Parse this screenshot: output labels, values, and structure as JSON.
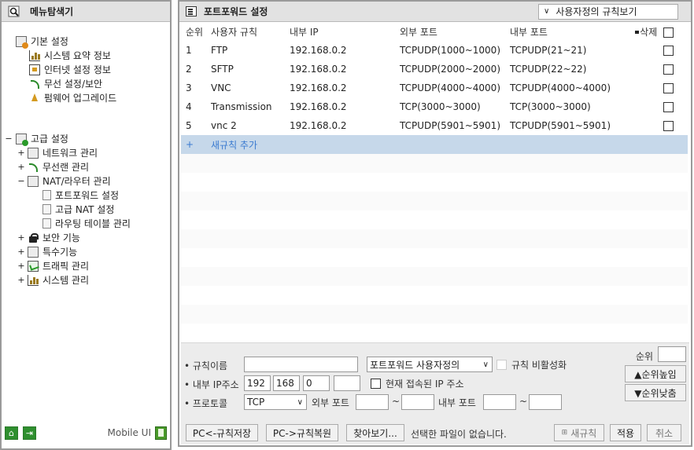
{
  "sidebar": {
    "title": "메뉴탐색기",
    "basic": {
      "label": "기본 설정",
      "items": [
        "시스템 요약 정보",
        "인터넷 설정 정보",
        "무선 설정/보안",
        "펌웨어 업그레이드"
      ]
    },
    "advanced": {
      "label": "고급 설정",
      "items": [
        {
          "toggle": "+",
          "label": "네트워크 관리"
        },
        {
          "toggle": "+",
          "label": "무선랜 관리"
        },
        {
          "toggle": "−",
          "label": "NAT/라우터 관리"
        },
        {
          "toggle": "+",
          "label": "보안 기능"
        },
        {
          "toggle": "+",
          "label": "특수기능"
        },
        {
          "toggle": "+",
          "label": "트래픽 관리"
        },
        {
          "toggle": "+",
          "label": "시스템 관리"
        }
      ],
      "nat_children": [
        "포트포워드 설정",
        "고급 NAT 설정",
        "라우팅 테이블 관리"
      ]
    },
    "advanced_toggle": "−",
    "footer": {
      "mobile_label": "Mobile UI"
    }
  },
  "main": {
    "title": "포트포워드 설정",
    "view_select": "사용자정의 규칙보기",
    "table": {
      "headers": [
        "순위",
        "사용자 규칙",
        "내부 IP",
        "외부 포트",
        "내부 포트",
        "삭제"
      ],
      "rows": [
        [
          "1",
          "FTP",
          "192.168.0.2",
          "TCPUDP(1000~1000)",
          "TCPUDP(21~21)"
        ],
        [
          "2",
          "SFTP",
          "192.168.0.2",
          "TCPUDP(2000~2000)",
          "TCPUDP(22~22)"
        ],
        [
          "3",
          "VNC",
          "192.168.0.2",
          "TCPUDP(4000~4000)",
          "TCPUDP(4000~4000)"
        ],
        [
          "4",
          "Transmission",
          "192.168.0.2",
          "TCP(3000~3000)",
          "TCP(3000~3000)"
        ],
        [
          "5",
          "vnc 2",
          "192.168.0.2",
          "TCPUDP(5901~5901)",
          "TCPUDP(5901~5901)"
        ]
      ],
      "add_row": {
        "icon": "+",
        "label": "새규칙 추가"
      }
    },
    "form": {
      "rule_name_label": "• 규칙이름",
      "rule_name_value": "",
      "rule_type": "포트포워드 사용자정의",
      "disable_label": "규칙 비활성화",
      "ip_label": "• 내부 IP주소",
      "ip": [
        "192",
        "168",
        "0",
        ""
      ],
      "current_ip_label": "현재 접속된 IP 주소",
      "protocol_label": "• 프로토콜",
      "protocol": "TCP",
      "ext_port_label": "외부 포트",
      "int_port_label": "내부 포트",
      "tilde": "~",
      "rank_label": "순위",
      "rank_up": "▲순위높임",
      "rank_down": "▼순위낮춤"
    },
    "buttons": {
      "save_to_pc": "PC<-규칙저장",
      "restore_from_pc": "PC->규칙복원",
      "browse": "찾아보기...",
      "no_file": "선택한 파일이 없습니다.",
      "new_rule": "새규칙",
      "apply": "적용",
      "cancel": "취소"
    }
  }
}
